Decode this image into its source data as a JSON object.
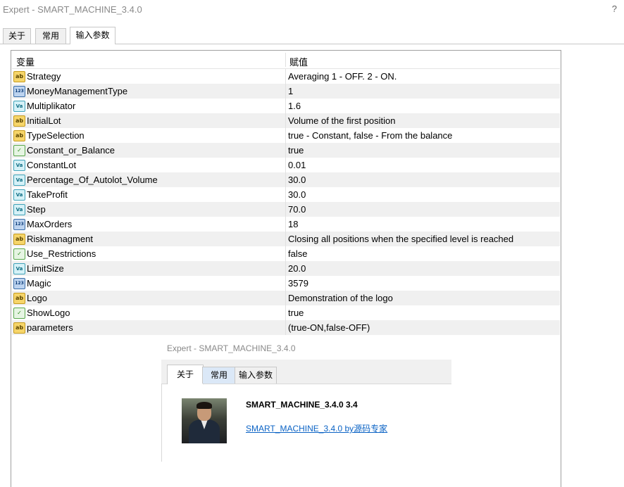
{
  "window": {
    "title": "Expert - SMART_MACHINE_3.4.0",
    "help": "?"
  },
  "tabs": [
    {
      "label": "关于"
    },
    {
      "label": "常用"
    },
    {
      "label": "输入参数"
    }
  ],
  "grid": {
    "col_variable": "变量",
    "col_value": "赋值",
    "rows": [
      {
        "icon": "ab",
        "name": "Strategy",
        "value": " Averaging 1 - OFF. 2 - ON."
      },
      {
        "icon": "123",
        "name": "MoneyManagementType",
        "value": "1"
      },
      {
        "icon": "Va",
        "name": "Multiplikator",
        "value": "1.6"
      },
      {
        "icon": "ab",
        "name": "InitialLot",
        "value": "Volume of the first position"
      },
      {
        "icon": "ab",
        "name": "TypeSelection",
        "value": "true - Constant, false - From the balance"
      },
      {
        "icon": "bool",
        "name": "Constant_or_Balance",
        "value": "true"
      },
      {
        "icon": "Va",
        "name": "ConstantLot",
        "value": "0.01"
      },
      {
        "icon": "Va",
        "name": "Percentage_Of_Autolot_Volume",
        "value": "30.0"
      },
      {
        "icon": "Va",
        "name": "TakeProfit",
        "value": "30.0"
      },
      {
        "icon": "Va",
        "name": "Step",
        "value": "70.0"
      },
      {
        "icon": "123",
        "name": "MaxOrders",
        "value": "18"
      },
      {
        "icon": "ab",
        "name": "Riskmanagment",
        "value": "Closing all positions when the specified level is reached"
      },
      {
        "icon": "bool",
        "name": "Use_Restrictions",
        "value": "false"
      },
      {
        "icon": "Va",
        "name": "LimitSize",
        "value": "20.0"
      },
      {
        "icon": "123",
        "name": "Magic",
        "value": "3579"
      },
      {
        "icon": "ab",
        "name": "Logo",
        "value": "Demonstration of the logo"
      },
      {
        "icon": "bool",
        "name": "ShowLogo",
        "value": "true"
      },
      {
        "icon": "ab",
        "name": "parameters",
        "value": "(true-ON,false-OFF)"
      }
    ]
  },
  "about_dialog": {
    "title": "Expert - SMART_MACHINE_3.4.0",
    "tabs": [
      {
        "label": "关于"
      },
      {
        "label": "常用"
      },
      {
        "label": "输入参数"
      }
    ],
    "product_name": "SMART_MACHINE_3.4.0 3.4",
    "product_link": "SMART_MACHINE_3.4.0 by源码专家"
  }
}
